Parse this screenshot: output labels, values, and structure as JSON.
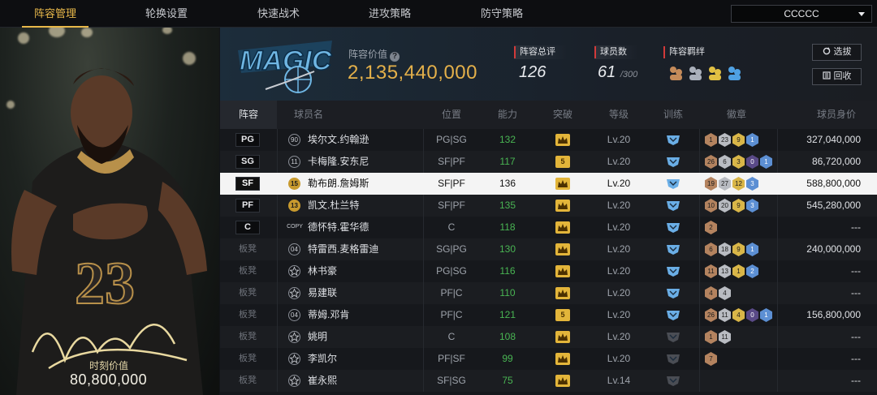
{
  "tabs": [
    {
      "label": "阵容管理",
      "active": true
    },
    {
      "label": "轮换设置",
      "active": false
    },
    {
      "label": "快速战术",
      "active": false
    },
    {
      "label": "进攻策略",
      "active": false
    },
    {
      "label": "防守策略",
      "active": false
    }
  ],
  "team_select": {
    "value": "CCCCC"
  },
  "card": {
    "signature_number": "23",
    "value_label": "时刻价值",
    "value": "80,800,000"
  },
  "header": {
    "team_logo_text": "MAGIC",
    "lineup_value_label": "阵容价值",
    "lineup_value": "2,135,440,000",
    "overall_label": "阵容总评",
    "overall_value": "126",
    "players_label": "球员数",
    "players_value": "61",
    "players_max": "/300",
    "bond_label": "阵容羁绊",
    "select_button": "选拔",
    "recycle_button": "回收"
  },
  "table_headers": [
    "阵容",
    "球员名",
    "位置",
    "能力",
    "突破",
    "等级",
    "训练",
    "徽章",
    "球员身价"
  ],
  "players": [
    {
      "slot": "PG",
      "bench": false,
      "num": "90",
      "num_style": "plain",
      "name": "埃尔文.约翰逊",
      "pos": "PG|SG",
      "ability": "132",
      "ability_green": true,
      "breakthrough": "",
      "level": "Lv.20",
      "train": "blue",
      "badges": [
        [
          "bronze",
          "1"
        ],
        [
          "silver",
          "23"
        ],
        [
          "gold",
          "9"
        ],
        [
          "blue",
          "1"
        ]
      ],
      "price": "327,040,000"
    },
    {
      "slot": "SG",
      "bench": false,
      "num": "11",
      "num_style": "plain",
      "name": "卡梅隆.安东尼",
      "pos": "SF|PF",
      "ability": "117",
      "ability_green": true,
      "breakthrough": "5",
      "level": "Lv.20",
      "train": "blue",
      "badges": [
        [
          "bronze",
          "26"
        ],
        [
          "silver",
          "6"
        ],
        [
          "gold",
          "3"
        ],
        [
          "purple",
          "0"
        ],
        [
          "blue",
          "1"
        ]
      ],
      "price": "86,720,000"
    },
    {
      "slot": "SF",
      "bench": false,
      "num": "15",
      "num_style": "gold",
      "name": "勒布朗.詹姆斯",
      "pos": "SF|PF",
      "ability": "136",
      "ability_green": false,
      "breakthrough": "",
      "level": "Lv.20",
      "train": "blue",
      "badges": [
        [
          "bronze",
          "19"
        ],
        [
          "silver",
          "27"
        ],
        [
          "gold",
          "12"
        ],
        [
          "blue",
          "3"
        ]
      ],
      "price": "588,800,000",
      "selected": true
    },
    {
      "slot": "PF",
      "bench": false,
      "num": "13",
      "num_style": "gold",
      "name": "凯文.杜兰特",
      "pos": "SF|PF",
      "ability": "135",
      "ability_green": true,
      "breakthrough": "",
      "level": "Lv.20",
      "train": "blue",
      "badges": [
        [
          "bronze",
          "10"
        ],
        [
          "silver",
          "20"
        ],
        [
          "gold",
          "9"
        ],
        [
          "blue",
          "3"
        ]
      ],
      "price": "545,280,000"
    },
    {
      "slot": "C",
      "bench": false,
      "num": "COPY",
      "num_style": "copy",
      "name": "德怀特.霍华德",
      "pos": "C",
      "ability": "118",
      "ability_green": true,
      "breakthrough": "",
      "level": "Lv.20",
      "train": "blue",
      "badges": [
        [
          "bronze",
          "2"
        ]
      ],
      "price": "---"
    },
    {
      "slot": "板凳",
      "bench": true,
      "num": "04",
      "num_style": "plain",
      "name": "特雷西.麦格雷迪",
      "pos": "SG|PG",
      "ability": "130",
      "ability_green": true,
      "breakthrough": "",
      "level": "Lv.20",
      "train": "blue",
      "badges": [
        [
          "bronze",
          "6"
        ],
        [
          "silver",
          "18"
        ],
        [
          "gold",
          "9"
        ],
        [
          "blue",
          "1"
        ]
      ],
      "price": "240,000,000"
    },
    {
      "slot": "板凳",
      "bench": true,
      "num": "",
      "num_style": "star",
      "name": "林书豪",
      "pos": "PG|SG",
      "ability": "116",
      "ability_green": true,
      "breakthrough": "",
      "level": "Lv.20",
      "train": "blue",
      "badges": [
        [
          "bronze",
          "11"
        ],
        [
          "silver",
          "13"
        ],
        [
          "gold",
          "1"
        ],
        [
          "blue",
          "2"
        ]
      ],
      "price": "---"
    },
    {
      "slot": "板凳",
      "bench": true,
      "num": "",
      "num_style": "star",
      "name": "易建联",
      "pos": "PF|C",
      "ability": "110",
      "ability_green": true,
      "breakthrough": "",
      "level": "Lv.20",
      "train": "blue",
      "badges": [
        [
          "bronze",
          "4"
        ],
        [
          "silver",
          "4"
        ]
      ],
      "price": "---"
    },
    {
      "slot": "板凳",
      "bench": true,
      "num": "04",
      "num_style": "plain",
      "name": "蒂姆.邓肯",
      "pos": "PF|C",
      "ability": "121",
      "ability_green": true,
      "breakthrough": "5",
      "level": "Lv.20",
      "train": "blue",
      "badges": [
        [
          "bronze",
          "26"
        ],
        [
          "silver",
          "11"
        ],
        [
          "gold",
          "4"
        ],
        [
          "purple",
          "0"
        ],
        [
          "blue",
          "1"
        ]
      ],
      "price": "156,800,000"
    },
    {
      "slot": "板凳",
      "bench": true,
      "num": "",
      "num_style": "star",
      "name": "姚明",
      "pos": "C",
      "ability": "108",
      "ability_green": true,
      "breakthrough": "",
      "level": "Lv.20",
      "train": "grey",
      "badges": [
        [
          "bronze",
          "1"
        ],
        [
          "silver",
          "11"
        ]
      ],
      "price": "---"
    },
    {
      "slot": "板凳",
      "bench": true,
      "num": "",
      "num_style": "star",
      "name": "李凯尔",
      "pos": "PF|SF",
      "ability": "99",
      "ability_green": true,
      "breakthrough": "",
      "level": "Lv.20",
      "train": "grey",
      "badges": [
        [
          "bronze",
          "7"
        ]
      ],
      "price": "---"
    },
    {
      "slot": "板凳",
      "bench": true,
      "num": "",
      "num_style": "star",
      "name": "崔永熙",
      "pos": "SF|SG",
      "ability": "75",
      "ability_green": true,
      "breakthrough": "",
      "level": "Lv.14",
      "train": "grey",
      "badges": [],
      "price": "---"
    }
  ]
}
